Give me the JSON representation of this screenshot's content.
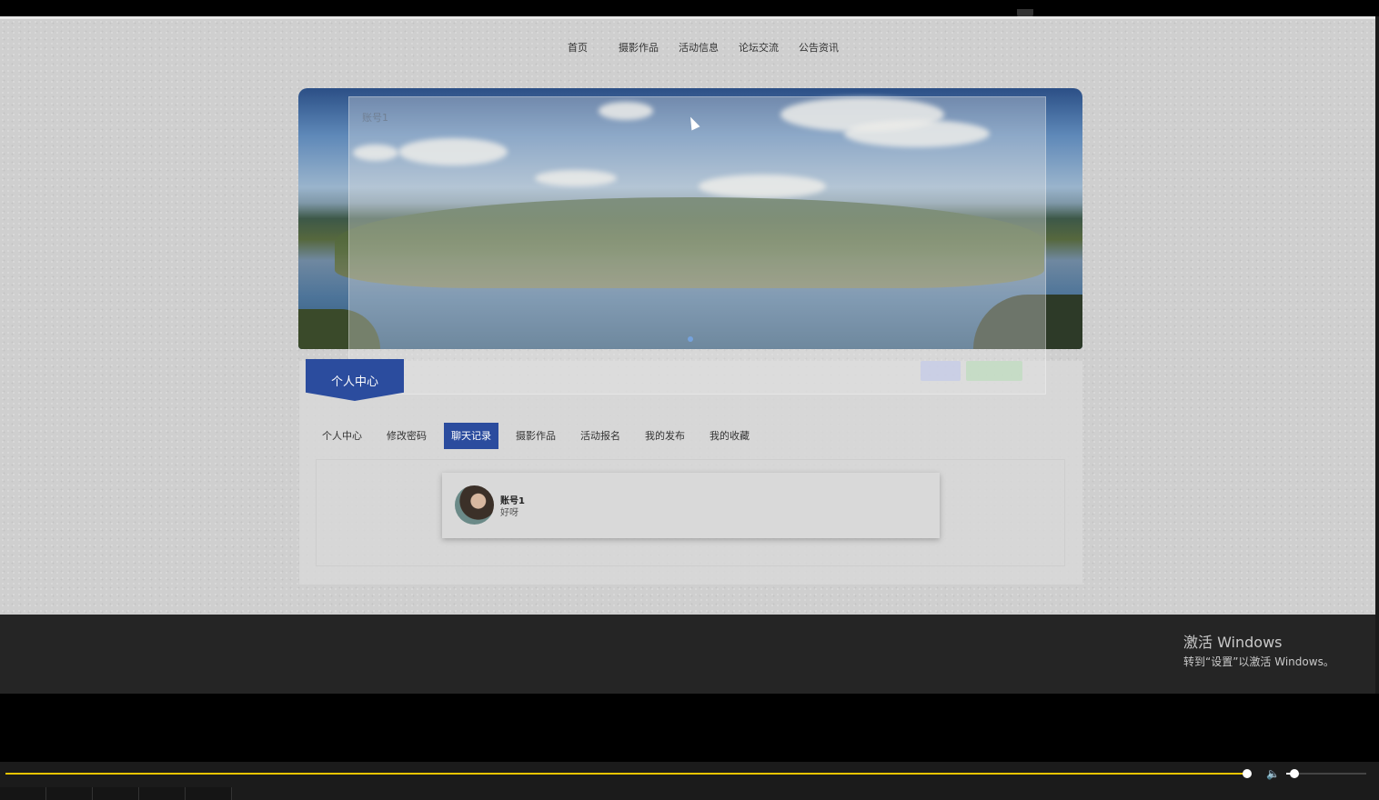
{
  "nav": {
    "items": [
      "首页",
      "摄影作品",
      "活动信息",
      "论坛交流",
      "公告资讯"
    ]
  },
  "overlay": {
    "title": "账号1"
  },
  "section_tag": "个人中心",
  "tabs": [
    {
      "label": "个人中心",
      "active": false
    },
    {
      "label": "修改密码",
      "active": false
    },
    {
      "label": "聊天记录",
      "active": true
    },
    {
      "label": "摄影作品",
      "active": false
    },
    {
      "label": "活动报名",
      "active": false
    },
    {
      "label": "我的发布",
      "active": false
    },
    {
      "label": "我的收藏",
      "active": false
    }
  ],
  "chat": {
    "name": "账号1",
    "last_message": "好呀"
  },
  "watermark": {
    "title": "激活 Windows",
    "subtitle": "转到“设置”以激活 Windows。"
  },
  "player": {
    "progress": 0.9,
    "volume": 0.1,
    "volume_icon": "speaker-icon"
  },
  "colors": {
    "accent": "#2b4c9e",
    "progress": "#e9c400"
  }
}
